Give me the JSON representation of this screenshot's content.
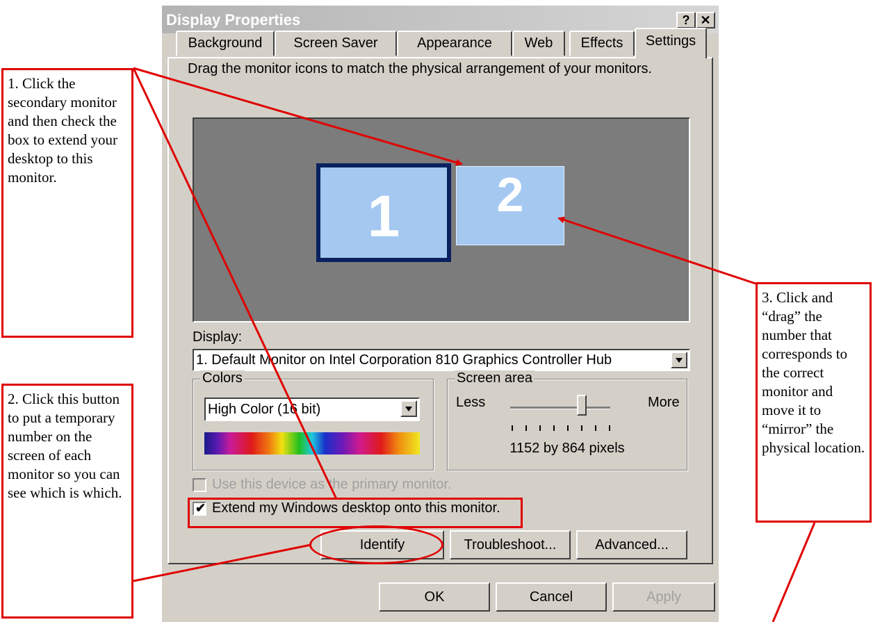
{
  "window": {
    "title": "Display Properties",
    "help_glyph": "?",
    "close_glyph": "✕"
  },
  "tabs": [
    {
      "label": "Background"
    },
    {
      "label": "Screen Saver"
    },
    {
      "label": "Appearance"
    },
    {
      "label": "Web"
    },
    {
      "label": "Effects"
    },
    {
      "label": "Settings",
      "active": true
    }
  ],
  "settings": {
    "instruction": "Drag the monitor icons to match the physical arrangement of your monitors.",
    "monitors": [
      {
        "number": "1",
        "selected": true
      },
      {
        "number": "2",
        "selected": false
      }
    ],
    "display_label": "Display:",
    "display_value": "1. Default Monitor on Intel Corporation 810 Graphics Controller Hub",
    "colors": {
      "title": "Colors",
      "value": "High Color (16 bit)"
    },
    "screen_area": {
      "title": "Screen area",
      "less": "Less",
      "more": "More",
      "resolution": "1152 by 864 pixels",
      "slider_position": 0.67
    },
    "primary_checkbox": {
      "label": "Use this device as the primary monitor.",
      "checked": false,
      "enabled": false
    },
    "extend_checkbox": {
      "label": "Extend my Windows desktop onto this monitor.",
      "checked": true
    },
    "buttons": {
      "identify": "Identify",
      "troubleshoot": "Troubleshoot...",
      "advanced": "Advanced..."
    }
  },
  "dialog_buttons": {
    "ok": "OK",
    "cancel": "Cancel",
    "apply": "Apply"
  },
  "annotations": {
    "note1": "1. Click the secondary monitor and then check the box to extend your desktop to this monitor.",
    "note2": "2. Click this button to put a temporary number on the screen of each monitor so you can see which is which.",
    "note3": "3. Click and “drag” the number that corresponds to the correct monitor and move it to “mirror” the physical location."
  },
  "colors": {
    "accent": "#e00000",
    "dialog_bg": "#d4d0c8",
    "monitor_fill": "#a4c8f0",
    "monitor_selected_border": "#0a2160",
    "monitor_area_bg": "#7c7c7c"
  }
}
